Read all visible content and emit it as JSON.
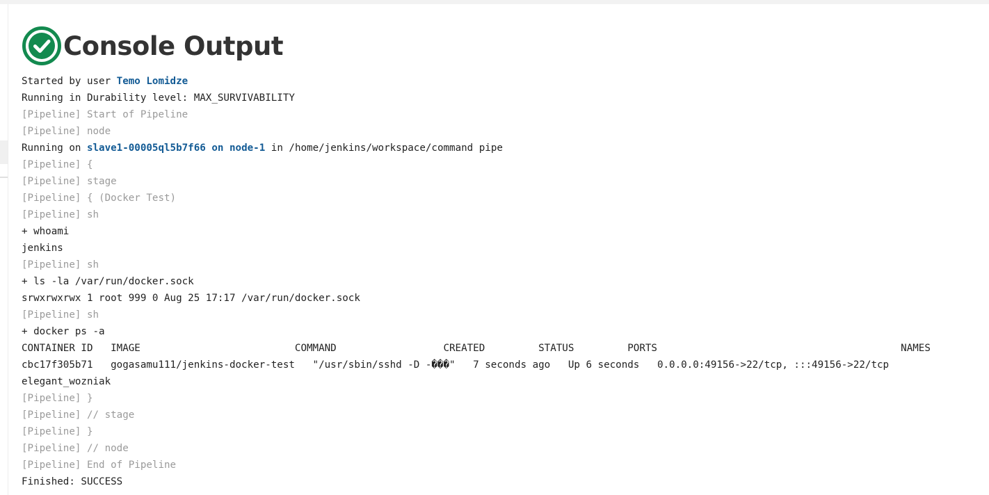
{
  "page": {
    "title": "Console Output",
    "status_icon": "success-check-icon",
    "status_color": "#138a4f"
  },
  "colors": {
    "link": "#135b95",
    "pipeline_text": "#9a9a9a",
    "text": "#222222"
  },
  "console": {
    "l01_a": "Started by user ",
    "l01_user": "Temo Lomidze",
    "l02": "Running in Durability level: MAX_SURVIVABILITY",
    "l03": "[Pipeline] Start of Pipeline",
    "l04": "[Pipeline] node",
    "l05_a": "Running on ",
    "l05_agent": "slave1-00005ql5b7f66",
    "l05_on": " on ",
    "l05_node": "node-1",
    "l05_b": " in /home/jenkins/workspace/command pipe",
    "l06": "[Pipeline] {",
    "l07": "[Pipeline] stage",
    "l08": "[Pipeline] { (Docker Test)",
    "l09": "[Pipeline] sh",
    "l10": "+ whoami",
    "l11": "jenkins",
    "l12": "[Pipeline] sh",
    "l13": "+ ls -la /var/run/docker.sock",
    "l14": "srwxrwxrwx 1 root 999 0 Aug 25 17:17 /var/run/docker.sock",
    "l15": "[Pipeline] sh",
    "l16": "+ docker ps -a",
    "l17": "CONTAINER ID   IMAGE                          COMMAND                  CREATED         STATUS         PORTS                                         NAMES",
    "l18": "cbc17f305b71   gogasamu111/jenkins-docker-test   \"/usr/sbin/sshd -D -���\"   7 seconds ago   Up 6 seconds   0.0.0.0:49156->22/tcp, :::49156->22/tcp",
    "l19": "elegant_wozniak",
    "l20": "[Pipeline] }",
    "l21": "[Pipeline] // stage",
    "l22": "[Pipeline] }",
    "l23": "[Pipeline] // node",
    "l24": "[Pipeline] End of Pipeline",
    "l25": "Finished: SUCCESS"
  }
}
